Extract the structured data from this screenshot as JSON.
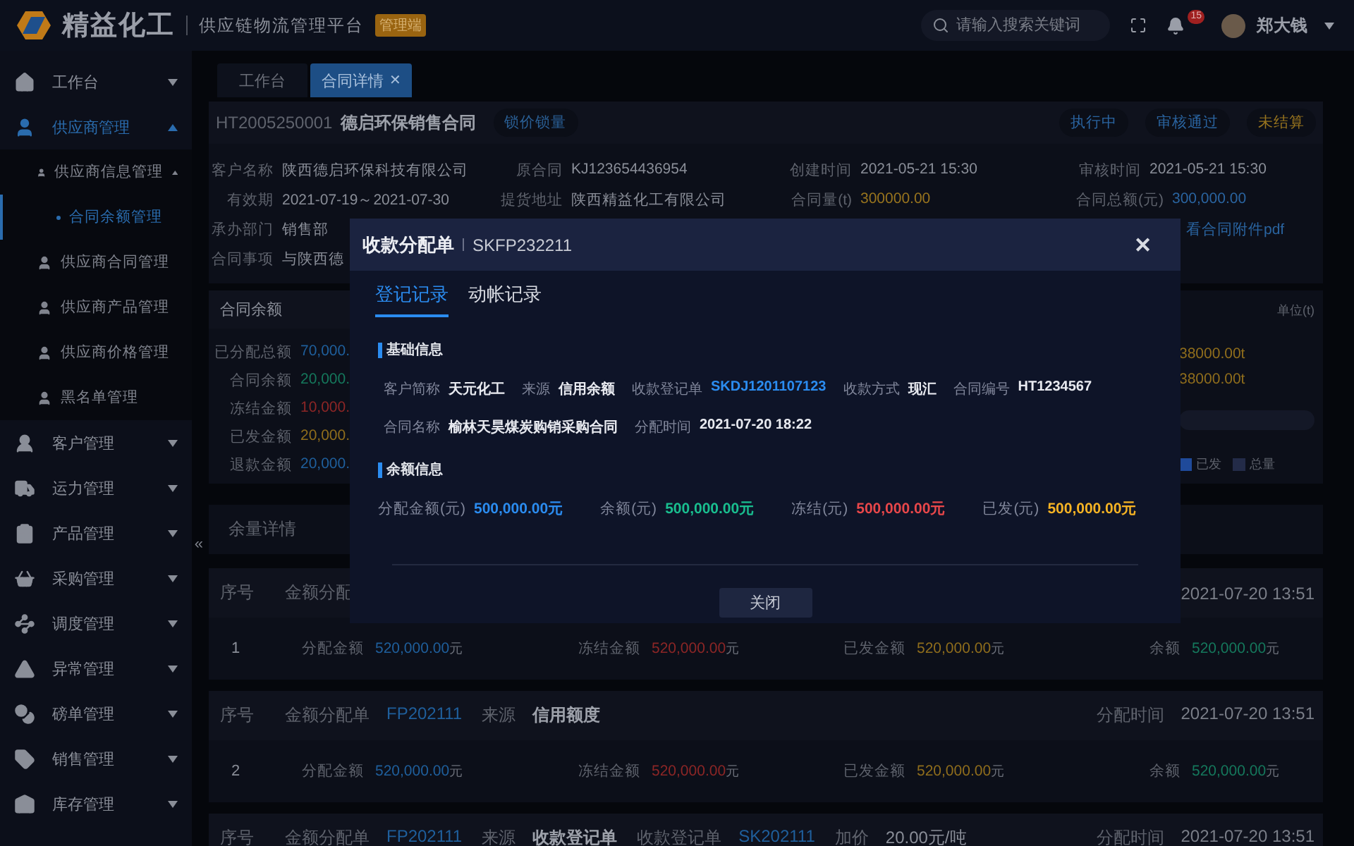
{
  "header": {
    "brand": "精益化工",
    "platform": "供应链物流管理平台",
    "badge": "管理端",
    "search": {
      "placeholder": "请输入搜索关键词"
    },
    "notifications": "15",
    "user": "郑大钱"
  },
  "sidebar": {
    "collapse_handle": "«",
    "items": [
      {
        "label": "工作台",
        "expanded": false
      },
      {
        "label": "供应商管理",
        "expanded": true,
        "children": [
          {
            "label": "供应商信息管理",
            "expanded": true,
            "selected": false,
            "children": [
              {
                "label": "合同余额管理",
                "selected": true
              }
            ]
          },
          {
            "label": "供应商合同管理",
            "selected": false
          },
          {
            "label": "供应商产品管理",
            "selected": false
          },
          {
            "label": "供应商价格管理",
            "selected": false
          },
          {
            "label": "黑名单管理",
            "selected": false
          }
        ]
      },
      {
        "label": "客户管理",
        "expanded": false
      },
      {
        "label": "运力管理",
        "expanded": false
      },
      {
        "label": "产品管理",
        "expanded": false
      },
      {
        "label": "采购管理",
        "expanded": false
      },
      {
        "label": "调度管理",
        "expanded": false
      },
      {
        "label": "异常管理",
        "expanded": false
      },
      {
        "label": "磅单管理",
        "expanded": false
      },
      {
        "label": "销售管理",
        "expanded": false
      },
      {
        "label": "库存管理",
        "expanded": false
      }
    ]
  },
  "tabs": [
    {
      "label": "工作台",
      "selected": false,
      "closable": false
    },
    {
      "label": "合同详情",
      "selected": true,
      "closable": true,
      "close": "✕"
    }
  ],
  "contract": {
    "code": "HT2005250001",
    "name": "德启环保销售合同",
    "tag": "锁价锁量",
    "status_tags": [
      {
        "label": "执行中",
        "color": "#2a64a0"
      },
      {
        "label": "审核通过",
        "color": "#2a64a0"
      },
      {
        "label": "未结算",
        "color": "#98741e"
      }
    ],
    "rows": [
      [
        {
          "label": "客户名称",
          "value": "陕西德启环保科技有限公司",
          "color": "#8a8e98"
        },
        {
          "label": "原合同",
          "value": "KJ123654436954",
          "color": "#8a8e98"
        },
        {
          "label": "创建时间",
          "value": "2021-05-21 15:30",
          "color": "#8a8e98"
        },
        {
          "label": "审核时间",
          "value": "2021-05-21 15:30",
          "color": "#8a8e98"
        }
      ],
      [
        {
          "label": "有效期",
          "value": "2021-07-19～2021-07-30",
          "color": "#8a8e98"
        },
        {
          "label": "提货地址",
          "value": "陕西精益化工有限公司",
          "color": "#8a8e98"
        },
        {
          "label": "合同量(t)",
          "value": "300000.00",
          "color": "#98741e"
        },
        {
          "label": "合同总额(元)",
          "value": "300,000.00",
          "color": "#2a64a0"
        }
      ],
      [
        {
          "label": "承办部门",
          "value": "销售部",
          "color": "#8a8e98"
        }
      ],
      [
        {
          "label": "合同事项",
          "value": "与陕西德",
          "color": "#8a8e98"
        }
      ]
    ],
    "attachment_link": "看合同附件pdf"
  },
  "balance": {
    "title": "合同余额",
    "rows": [
      {
        "label": "已分配总额",
        "value": "70,000.",
        "color": "#1f5f9c"
      },
      {
        "label": "合同余额",
        "value": "20,000.",
        "color": "#15785c"
      },
      {
        "label": "冻结金额",
        "value": "10,000.",
        "color": "#8c2626"
      },
      {
        "label": "已发金额",
        "value": "20,000.",
        "color": "#8f6d1c"
      },
      {
        "label": "退款金额",
        "value": "20,000.",
        "color": "#1f5f9c"
      }
    ]
  },
  "quantity": {
    "unit": "单位(t)",
    "values": [
      "38000.00t",
      "38000.00t"
    ],
    "legend": [
      {
        "label": "已发",
        "color": "#1f4a9a"
      },
      {
        "label": "总量",
        "color": "#232b48"
      }
    ]
  },
  "remaining_title": "余量详情",
  "allocations": [
    {
      "header": [
        {
          "label": "序号"
        },
        {
          "label": "金额分配"
        }
      ],
      "time": "2021-07-20 13:51",
      "index": "1",
      "amounts": [
        {
          "label": "分配金额",
          "value": "520,000.00",
          "unit": "元",
          "color": "#1f5f9c"
        },
        {
          "label": "冻结金额",
          "value": "520,000.00",
          "unit": "元",
          "color": "#8c2626"
        },
        {
          "label": "已发金额",
          "value": "520,000.00",
          "unit": "元",
          "color": "#8f6d1c"
        },
        {
          "label": "余额",
          "value": "520,000.00",
          "unit": "元",
          "color": "#15785c"
        }
      ]
    },
    {
      "header": [
        {
          "label": "序号"
        },
        {
          "label": "金额分配单",
          "value": "FP202111",
          "color": "#1f5f9c",
          "bold": false
        },
        {
          "label": "来源",
          "value": "信用额度",
          "color": "#9da1aa",
          "bold": true
        }
      ],
      "time_label": "分配时间",
      "time": "2021-07-20 13:51",
      "index": "2",
      "amounts": [
        {
          "label": "分配金额",
          "value": "520,000.00",
          "unit": "元",
          "color": "#1f5f9c"
        },
        {
          "label": "冻结金额",
          "value": "520,000.00",
          "unit": "元",
          "color": "#8c2626"
        },
        {
          "label": "已发金额",
          "value": "520,000.00",
          "unit": "元",
          "color": "#8f6d1c"
        },
        {
          "label": "余额",
          "value": "520,000.00",
          "unit": "元",
          "color": "#15785c"
        }
      ]
    },
    {
      "header": [
        {
          "label": "序号"
        },
        {
          "label": "金额分配单",
          "value": "FP202111",
          "color": "#1f5f9c",
          "bold": false
        },
        {
          "label": "来源",
          "value": "收款登记单",
          "color": "#9da1aa",
          "bold": true
        },
        {
          "label": "收款登记单",
          "value": "SK202111",
          "color": "#1f5f9c",
          "bold": false
        },
        {
          "label": "加价",
          "value": "20.00元/吨",
          "color": "#8a8e98",
          "bold": false
        }
      ],
      "time_label": "分配时间",
      "time": "2021-07-20 13:51"
    }
  ],
  "modal": {
    "title": "收款分配单",
    "code": "SKFP232211",
    "close": "✕",
    "tabs": [
      {
        "label": "登记记录",
        "selected": true
      },
      {
        "label": "动帐记录",
        "selected": false
      }
    ],
    "basic_title": "基础信息",
    "basic_rows": [
      [
        {
          "label": "客户简称",
          "value": "天元化工",
          "color": "#e8eaf0"
        },
        {
          "label": "来源",
          "value": "信用余额",
          "color": "#e8eaf0"
        },
        {
          "label": "收款登记单",
          "value": "SKDJ1201107123",
          "color": "#2b8cf0"
        },
        {
          "label": "收款方式",
          "value": "现汇",
          "color": "#e8eaf0"
        },
        {
          "label": "合同编号",
          "value": "HT1234567",
          "color": "#e8eaf0"
        }
      ],
      [
        {
          "label": "合同名称",
          "value": "榆林天昊煤炭购销采购合同",
          "color": "#e8eaf0"
        },
        {
          "label": "分配时间",
          "value": "2021-07-20 18:22",
          "color": "#e8eaf0"
        }
      ]
    ],
    "amount_title": "余额信息",
    "amounts": [
      {
        "label": "分配金额(元)",
        "value": "500,000.00元",
        "color": "#2b8cf0"
      },
      {
        "label": "余额(元)",
        "value": "500,000.00元",
        "color": "#19be8f"
      },
      {
        "label": "冻结(元)",
        "value": "500,000.00元",
        "color": "#e8474a"
      },
      {
        "label": "已发(元)",
        "value": "500,000.00元",
        "color": "#f5b324"
      }
    ],
    "button": "关闭"
  }
}
